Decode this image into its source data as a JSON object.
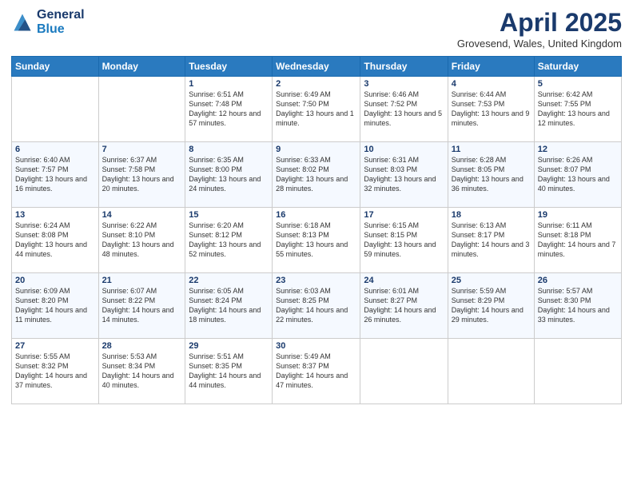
{
  "logo": {
    "general": "General",
    "blue": "Blue"
  },
  "header": {
    "title": "April 2025",
    "location": "Grovesend, Wales, United Kingdom"
  },
  "weekdays": [
    "Sunday",
    "Monday",
    "Tuesday",
    "Wednesday",
    "Thursday",
    "Friday",
    "Saturday"
  ],
  "weeks": [
    [
      null,
      null,
      {
        "day": 1,
        "sunrise": "6:51 AM",
        "sunset": "7:48 PM",
        "daylight": "12 hours and 57 minutes."
      },
      {
        "day": 2,
        "sunrise": "6:49 AM",
        "sunset": "7:50 PM",
        "daylight": "13 hours and 1 minute."
      },
      {
        "day": 3,
        "sunrise": "6:46 AM",
        "sunset": "7:52 PM",
        "daylight": "13 hours and 5 minutes."
      },
      {
        "day": 4,
        "sunrise": "6:44 AM",
        "sunset": "7:53 PM",
        "daylight": "13 hours and 9 minutes."
      },
      {
        "day": 5,
        "sunrise": "6:42 AM",
        "sunset": "7:55 PM",
        "daylight": "13 hours and 12 minutes."
      }
    ],
    [
      {
        "day": 6,
        "sunrise": "6:40 AM",
        "sunset": "7:57 PM",
        "daylight": "13 hours and 16 minutes."
      },
      {
        "day": 7,
        "sunrise": "6:37 AM",
        "sunset": "7:58 PM",
        "daylight": "13 hours and 20 minutes."
      },
      {
        "day": 8,
        "sunrise": "6:35 AM",
        "sunset": "8:00 PM",
        "daylight": "13 hours and 24 minutes."
      },
      {
        "day": 9,
        "sunrise": "6:33 AM",
        "sunset": "8:02 PM",
        "daylight": "13 hours and 28 minutes."
      },
      {
        "day": 10,
        "sunrise": "6:31 AM",
        "sunset": "8:03 PM",
        "daylight": "13 hours and 32 minutes."
      },
      {
        "day": 11,
        "sunrise": "6:28 AM",
        "sunset": "8:05 PM",
        "daylight": "13 hours and 36 minutes."
      },
      {
        "day": 12,
        "sunrise": "6:26 AM",
        "sunset": "8:07 PM",
        "daylight": "13 hours and 40 minutes."
      }
    ],
    [
      {
        "day": 13,
        "sunrise": "6:24 AM",
        "sunset": "8:08 PM",
        "daylight": "13 hours and 44 minutes."
      },
      {
        "day": 14,
        "sunrise": "6:22 AM",
        "sunset": "8:10 PM",
        "daylight": "13 hours and 48 minutes."
      },
      {
        "day": 15,
        "sunrise": "6:20 AM",
        "sunset": "8:12 PM",
        "daylight": "13 hours and 52 minutes."
      },
      {
        "day": 16,
        "sunrise": "6:18 AM",
        "sunset": "8:13 PM",
        "daylight": "13 hours and 55 minutes."
      },
      {
        "day": 17,
        "sunrise": "6:15 AM",
        "sunset": "8:15 PM",
        "daylight": "13 hours and 59 minutes."
      },
      {
        "day": 18,
        "sunrise": "6:13 AM",
        "sunset": "8:17 PM",
        "daylight": "14 hours and 3 minutes."
      },
      {
        "day": 19,
        "sunrise": "6:11 AM",
        "sunset": "8:18 PM",
        "daylight": "14 hours and 7 minutes."
      }
    ],
    [
      {
        "day": 20,
        "sunrise": "6:09 AM",
        "sunset": "8:20 PM",
        "daylight": "14 hours and 11 minutes."
      },
      {
        "day": 21,
        "sunrise": "6:07 AM",
        "sunset": "8:22 PM",
        "daylight": "14 hours and 14 minutes."
      },
      {
        "day": 22,
        "sunrise": "6:05 AM",
        "sunset": "8:24 PM",
        "daylight": "14 hours and 18 minutes."
      },
      {
        "day": 23,
        "sunrise": "6:03 AM",
        "sunset": "8:25 PM",
        "daylight": "14 hours and 22 minutes."
      },
      {
        "day": 24,
        "sunrise": "6:01 AM",
        "sunset": "8:27 PM",
        "daylight": "14 hours and 26 minutes."
      },
      {
        "day": 25,
        "sunrise": "5:59 AM",
        "sunset": "8:29 PM",
        "daylight": "14 hours and 29 minutes."
      },
      {
        "day": 26,
        "sunrise": "5:57 AM",
        "sunset": "8:30 PM",
        "daylight": "14 hours and 33 minutes."
      }
    ],
    [
      {
        "day": 27,
        "sunrise": "5:55 AM",
        "sunset": "8:32 PM",
        "daylight": "14 hours and 37 minutes."
      },
      {
        "day": 28,
        "sunrise": "5:53 AM",
        "sunset": "8:34 PM",
        "daylight": "14 hours and 40 minutes."
      },
      {
        "day": 29,
        "sunrise": "5:51 AM",
        "sunset": "8:35 PM",
        "daylight": "14 hours and 44 minutes."
      },
      {
        "day": 30,
        "sunrise": "5:49 AM",
        "sunset": "8:37 PM",
        "daylight": "14 hours and 47 minutes."
      },
      null,
      null,
      null
    ]
  ]
}
